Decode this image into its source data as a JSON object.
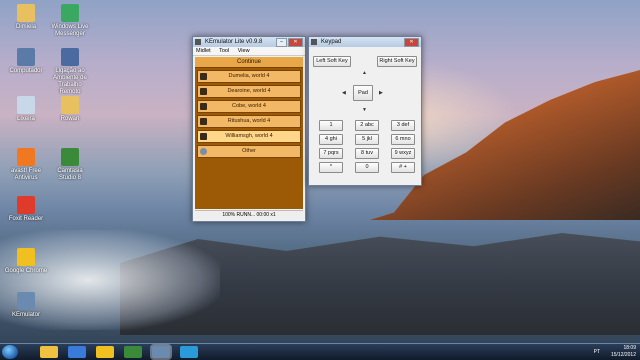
{
  "desktop": {
    "icons": [
      {
        "label": "Dimiela",
        "icon": "folder-icon",
        "color": "#e8c060"
      },
      {
        "label": "Windows Live Messenger",
        "icon": "messenger-icon",
        "color": "#3aa860"
      },
      {
        "label": "Computador",
        "icon": "computer-icon",
        "color": "#5a7aa8"
      },
      {
        "label": "Ligação ao Ambiente de Trabalho Remoto",
        "icon": "remote-desktop-icon",
        "color": "#4a6aa0"
      },
      {
        "label": "Lixeira",
        "icon": "recycle-bin-icon",
        "color": "#c8d8e8"
      },
      {
        "label": "Rowan",
        "icon": "folder-icon",
        "color": "#e8c060"
      },
      {
        "label": "avast! Free Antivirus",
        "icon": "avast-icon",
        "color": "#f07820"
      },
      {
        "label": "Camtasia Studio 8",
        "icon": "camtasia-icon",
        "color": "#3a8a3a"
      },
      {
        "label": "Foxit Reader",
        "icon": "foxit-reader-icon",
        "color": "#e03a2a"
      },
      {
        "label": "Google Chrome",
        "icon": "chrome-icon",
        "color": "#f0c020"
      },
      {
        "label": "KEmulator",
        "icon": "kemulator-icon",
        "color": "#6a8ab0"
      }
    ]
  },
  "emulator": {
    "title": "KEmulator Lite v0.9.8",
    "menu": [
      "Midlet",
      "Tool",
      "View"
    ],
    "command_bar": "Continue",
    "rows": [
      "Dumelia, world 4",
      "Dearoine, world 4",
      "Cobe, world 4",
      "Ritushua, world 4",
      "Williamsgh, world 4",
      "Other"
    ],
    "status": "100% RUNN... 00:00 x1"
  },
  "keypad": {
    "title": "Keypad",
    "left_soft": "Left Soft Key",
    "right_soft": "Right Soft Key",
    "pad": "Pad",
    "keys": [
      "1",
      "2 abc",
      "3 def",
      "4 ghi",
      "5 jkl",
      "6 mno",
      "7 pqrs",
      "8 tuv",
      "9 wxyz",
      "*",
      "0",
      "# +"
    ]
  },
  "taskbar": {
    "apps": [
      "explorer-icon",
      "media-player-icon",
      "chrome-icon",
      "camtasia-icon",
      "kemulator-icon",
      "skype-icon"
    ],
    "language": "PT",
    "time": "18:09",
    "date": "15/12/2012"
  }
}
